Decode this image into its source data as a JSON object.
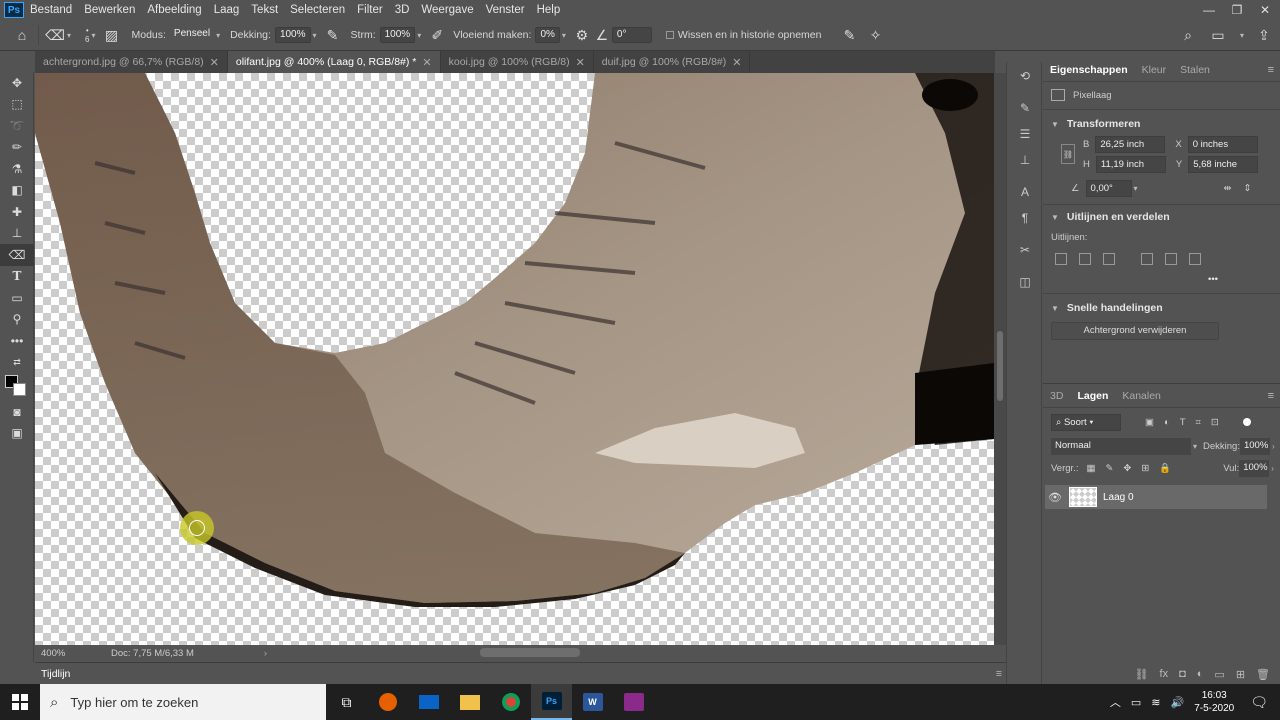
{
  "app": {
    "logo": "Ps"
  },
  "menu": [
    "Bestand",
    "Bewerken",
    "Afbeelding",
    "Laag",
    "Tekst",
    "Selecteren",
    "Filter",
    "3D",
    "Weergave",
    "Venster",
    "Help"
  ],
  "window_controls": {
    "minimize": "—",
    "restore": "❐",
    "close": "✕"
  },
  "options": {
    "brush_size": "6",
    "mode_label": "Modus:",
    "mode_value": "Penseel",
    "opacity_label": "Dekking:",
    "opacity_value": "100%",
    "flow_label": "Strm:",
    "flow_value": "100%",
    "smoothing_label": "Vloeiend maken:",
    "smoothing_value": "0%",
    "angle_value": "0°",
    "erase_history_label": "Wissen en in historie opnemen"
  },
  "tabs": [
    {
      "label": "achtergrond.jpg @ 66,7% (RGB/8)",
      "active": false
    },
    {
      "label": "olifant.jpg @ 400% (Laag 0, RGB/8#) *",
      "active": true
    },
    {
      "label": "kooi.jpg @ 100% (RGB/8)",
      "active": false
    },
    {
      "label": "duif.jpg @ 100% (RGB/8#)",
      "active": false
    }
  ],
  "status": {
    "zoom": "400%",
    "doc": "Doc: 7,75 M/6,33 M"
  },
  "timeline": {
    "label": "Tijdlijn"
  },
  "properties": {
    "tabs": [
      "Eigenschappen",
      "Kleur",
      "Stalen"
    ],
    "layer_type": "Pixellaag",
    "transform_title": "Transformeren",
    "w_label": "B",
    "w_value": "26,25 inch",
    "x_label": "X",
    "x_value": "0 inches",
    "h_label": "H",
    "h_value": "11,19 inch",
    "y_label": "Y",
    "y_value": "5,68 inche",
    "angle_value": "0,00°",
    "align_title": "Uitlijnen en verdelen",
    "align_label": "Uitlijnen:",
    "more": "•••",
    "quick_title": "Snelle handelingen",
    "remove_bg": "Achtergrond verwijderen"
  },
  "layers": {
    "tabs": [
      "3D",
      "Lagen",
      "Kanalen"
    ],
    "filter_kind": "Soort",
    "blend_mode": "Normaal",
    "opacity_label": "Dekking:",
    "opacity_value": "100%",
    "lock_label": "Vergr.:",
    "fill_label": "Vul:",
    "fill_value": "100%",
    "layer_name": "Laag 0"
  },
  "taskbar": {
    "search_placeholder": "Typ hier om te zoeken",
    "ps_label": "Ps",
    "word_label": "W",
    "time": "16:03",
    "date": "7-5-2020"
  }
}
